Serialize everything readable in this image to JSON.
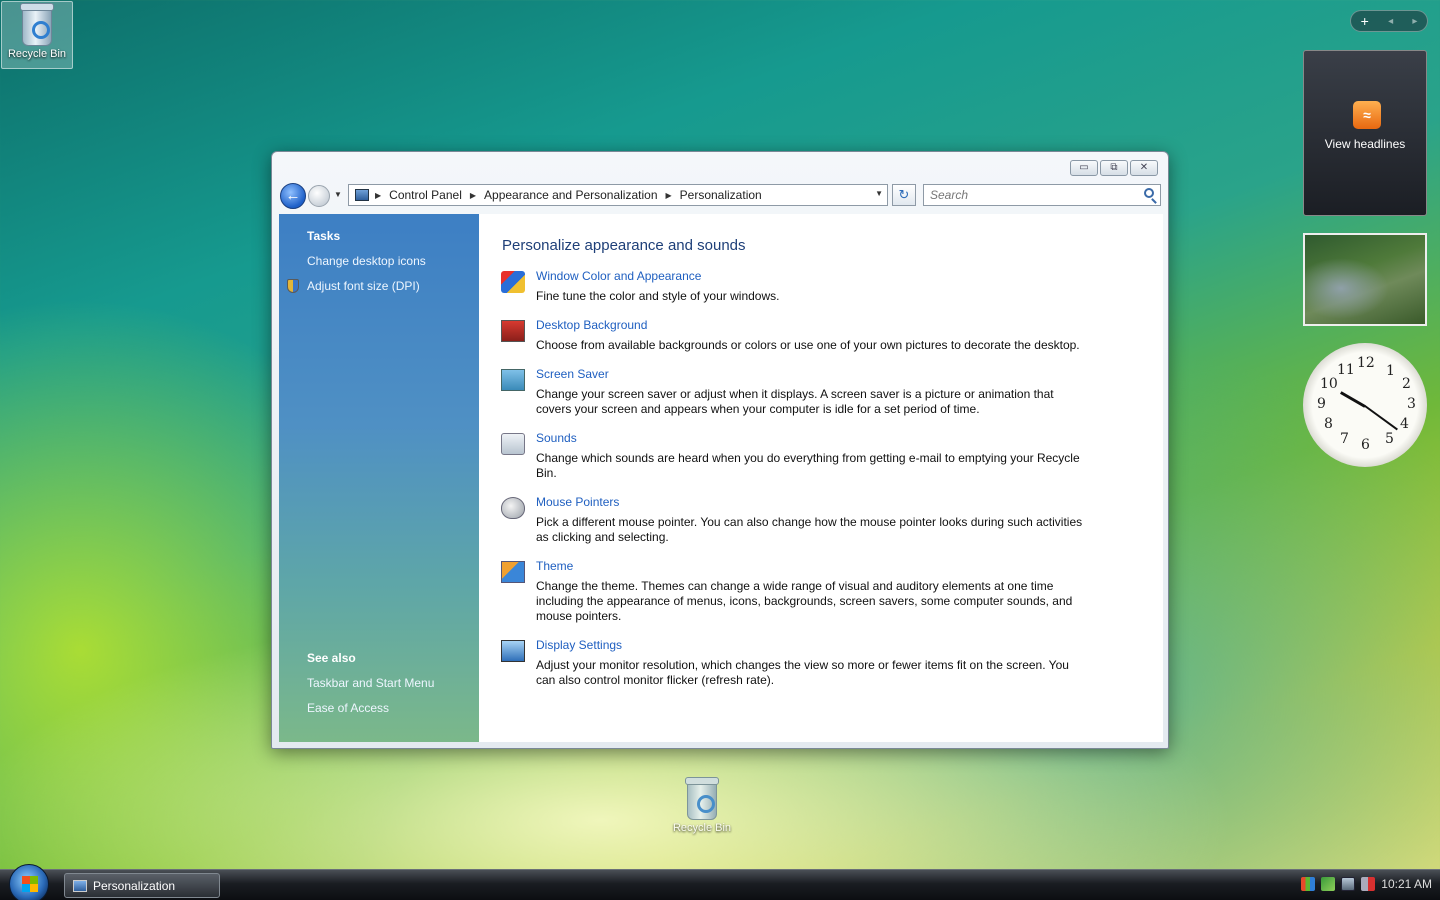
{
  "desktop": {
    "icons": [
      {
        "label": "Recycle Bin"
      },
      {
        "label": "Recycle Bin"
      }
    ]
  },
  "window": {
    "controls": {
      "minimize": "▭",
      "maximize": "⧉",
      "close": "✕"
    },
    "breadcrumb": [
      "Control Panel",
      "Appearance and Personalization",
      "Personalization"
    ],
    "search_placeholder": "Search",
    "sidebar": {
      "tasks_heading": "Tasks",
      "tasks": [
        "Change desktop icons",
        "Adjust font size (DPI)"
      ],
      "see_also_heading": "See also",
      "see_also": [
        "Taskbar and Start Menu",
        "Ease of Access"
      ]
    },
    "content": {
      "title": "Personalize appearance and sounds",
      "items": [
        {
          "icon": "window-color-icon",
          "link": "Window Color and Appearance",
          "desc": "Fine tune the color and style of your windows."
        },
        {
          "icon": "desktop-background-icon",
          "link": "Desktop Background",
          "desc": "Choose from available backgrounds or colors or use one of your own pictures to decorate the desktop."
        },
        {
          "icon": "screen-saver-icon",
          "link": "Screen Saver",
          "desc": "Change your screen saver or adjust when it displays. A screen saver is a picture or animation that covers your screen and appears when your computer is idle for a set period of time."
        },
        {
          "icon": "sounds-icon",
          "link": "Sounds",
          "desc": "Change which sounds are heard when you do everything from getting e-mail to emptying your Recycle Bin."
        },
        {
          "icon": "mouse-pointers-icon",
          "link": "Mouse Pointers",
          "desc": "Pick a different mouse pointer. You can also change how the mouse pointer looks during such activities as clicking and selecting."
        },
        {
          "icon": "theme-icon",
          "link": "Theme",
          "desc": "Change the theme. Themes can change a wide range of visual and auditory elements at one time including the appearance of menus, icons, backgrounds, screen savers, some computer sounds, and mouse pointers."
        },
        {
          "icon": "display-settings-icon",
          "link": "Display Settings",
          "desc": "Adjust your monitor resolution, which changes the view so more or fewer items fit on the screen. You can also control monitor flicker (refresh rate)."
        }
      ]
    }
  },
  "gadgets": {
    "control": {
      "add": "+",
      "prev": "◂",
      "next": "▸"
    },
    "feed_label": "View headlines",
    "rss_symbol": "≈",
    "clock_numbers": [
      "12",
      "1",
      "2",
      "3",
      "4",
      "5",
      "6",
      "7",
      "8",
      "9",
      "10",
      "11"
    ]
  },
  "taskbar": {
    "window_button": "Personalization",
    "clock": "10:21 AM"
  },
  "colors": {
    "link": "#1f5fc0",
    "title": "#1e3f78"
  }
}
